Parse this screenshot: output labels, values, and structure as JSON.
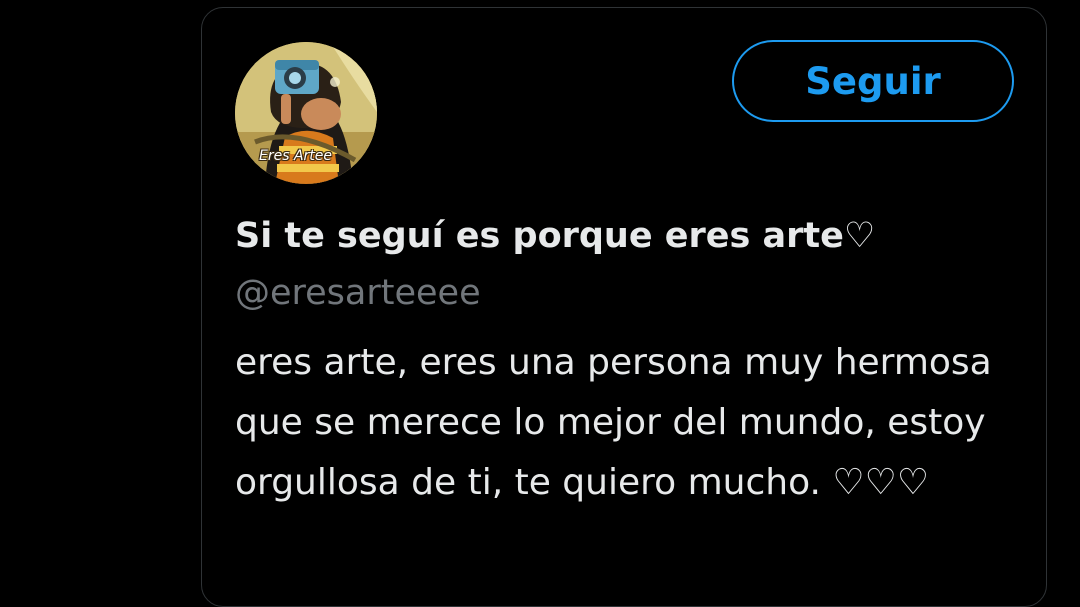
{
  "profile_card": {
    "avatar": {
      "caption": "Eres Artee"
    },
    "follow_label": "Seguir",
    "display_name": "Si te seguí es porque eres arte♡",
    "handle": "@eresarteeee",
    "bio": "eres arte, eres una persona muy hermosa que se merece lo mejor del mundo, estoy orgullosa de ti, te quiero mucho. ♡♡♡"
  },
  "colors": {
    "background": "#000000",
    "accent": "#1d9bf0",
    "text_primary": "#e7e9ea",
    "text_secondary": "#71767b",
    "border": "#2f3336"
  }
}
